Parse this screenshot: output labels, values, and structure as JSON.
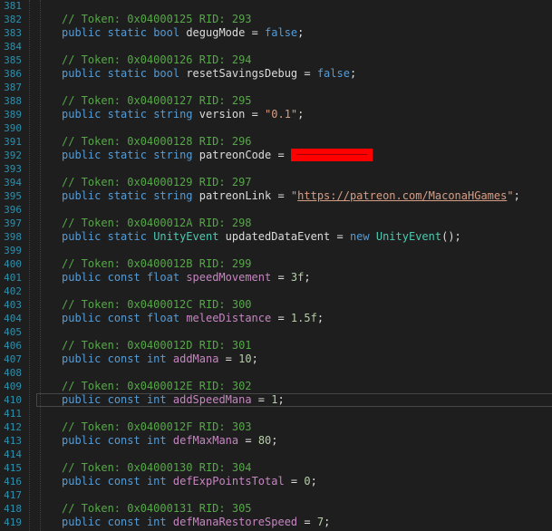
{
  "editor": {
    "current_line": "410",
    "lines": [
      {
        "n": "381",
        "code": []
      },
      {
        "n": "382",
        "code": [
          {
            "t": "// Token: 0x04000125 RID: 293",
            "c": "cm"
          }
        ]
      },
      {
        "n": "383",
        "code": [
          {
            "t": "public",
            "c": "kw"
          },
          {
            "t": " "
          },
          {
            "t": "static",
            "c": "kw"
          },
          {
            "t": " "
          },
          {
            "t": "bool",
            "c": "kw"
          },
          {
            "t": " degugMode = "
          },
          {
            "t": "false",
            "c": "kw"
          },
          {
            "t": ";"
          }
        ]
      },
      {
        "n": "384",
        "code": []
      },
      {
        "n": "385",
        "code": [
          {
            "t": "// Token: 0x04000126 RID: 294",
            "c": "cm"
          }
        ]
      },
      {
        "n": "386",
        "code": [
          {
            "t": "public",
            "c": "kw"
          },
          {
            "t": " "
          },
          {
            "t": "static",
            "c": "kw"
          },
          {
            "t": " "
          },
          {
            "t": "bool",
            "c": "kw"
          },
          {
            "t": " resetSavingsDebug = "
          },
          {
            "t": "false",
            "c": "kw"
          },
          {
            "t": ";"
          }
        ]
      },
      {
        "n": "387",
        "code": []
      },
      {
        "n": "388",
        "code": [
          {
            "t": "// Token: 0x04000127 RID: 295",
            "c": "cm"
          }
        ]
      },
      {
        "n": "389",
        "code": [
          {
            "t": "public",
            "c": "kw"
          },
          {
            "t": " "
          },
          {
            "t": "static",
            "c": "kw"
          },
          {
            "t": " "
          },
          {
            "t": "string",
            "c": "kw"
          },
          {
            "t": " version = "
          },
          {
            "t": "\"0.1\"",
            "c": "str"
          },
          {
            "t": ";"
          }
        ]
      },
      {
        "n": "390",
        "code": []
      },
      {
        "n": "391",
        "code": [
          {
            "t": "// Token: 0x04000128 RID: 296",
            "c": "cm"
          }
        ]
      },
      {
        "n": "392",
        "code": [
          {
            "t": "public",
            "c": "kw"
          },
          {
            "t": " "
          },
          {
            "t": "static",
            "c": "kw"
          },
          {
            "t": " "
          },
          {
            "t": "string",
            "c": "kw"
          },
          {
            "t": " patreonCode = "
          },
          {
            "t": "",
            "c": "redact"
          }
        ]
      },
      {
        "n": "393",
        "code": []
      },
      {
        "n": "394",
        "code": [
          {
            "t": "// Token: 0x04000129 RID: 297",
            "c": "cm"
          }
        ]
      },
      {
        "n": "395",
        "code": [
          {
            "t": "public",
            "c": "kw"
          },
          {
            "t": " "
          },
          {
            "t": "static",
            "c": "kw"
          },
          {
            "t": " "
          },
          {
            "t": "string",
            "c": "kw"
          },
          {
            "t": " patreonLink = "
          },
          {
            "t": "\"",
            "c": "str"
          },
          {
            "t": "https://patreon.com/MaconaHGames",
            "c": "lnk"
          },
          {
            "t": "\"",
            "c": "str"
          },
          {
            "t": ";"
          }
        ]
      },
      {
        "n": "396",
        "code": []
      },
      {
        "n": "397",
        "code": [
          {
            "t": "// Token: 0x0400012A RID: 298",
            "c": "cm"
          }
        ]
      },
      {
        "n": "398",
        "code": [
          {
            "t": "public",
            "c": "kw"
          },
          {
            "t": " "
          },
          {
            "t": "static",
            "c": "kw"
          },
          {
            "t": " "
          },
          {
            "t": "UnityEvent",
            "c": "typ"
          },
          {
            "t": " updatedDataEvent = "
          },
          {
            "t": "new",
            "c": "kw"
          },
          {
            "t": " "
          },
          {
            "t": "UnityEvent",
            "c": "typ"
          },
          {
            "t": "();"
          }
        ]
      },
      {
        "n": "399",
        "code": []
      },
      {
        "n": "400",
        "code": [
          {
            "t": "// Token: 0x0400012B RID: 299",
            "c": "cm"
          }
        ]
      },
      {
        "n": "401",
        "code": [
          {
            "t": "public",
            "c": "kw"
          },
          {
            "t": " "
          },
          {
            "t": "const",
            "c": "kw"
          },
          {
            "t": " "
          },
          {
            "t": "float",
            "c": "kw"
          },
          {
            "t": " "
          },
          {
            "t": "speedMovement",
            "c": "cst"
          },
          {
            "t": " = "
          },
          {
            "t": "3f",
            "c": "num"
          },
          {
            "t": ";"
          }
        ]
      },
      {
        "n": "402",
        "code": []
      },
      {
        "n": "403",
        "code": [
          {
            "t": "// Token: 0x0400012C RID: 300",
            "c": "cm"
          }
        ]
      },
      {
        "n": "404",
        "code": [
          {
            "t": "public",
            "c": "kw"
          },
          {
            "t": " "
          },
          {
            "t": "const",
            "c": "kw"
          },
          {
            "t": " "
          },
          {
            "t": "float",
            "c": "kw"
          },
          {
            "t": " "
          },
          {
            "t": "meleeDistance",
            "c": "cst"
          },
          {
            "t": " = "
          },
          {
            "t": "1.5f",
            "c": "num"
          },
          {
            "t": ";"
          }
        ]
      },
      {
        "n": "405",
        "code": []
      },
      {
        "n": "406",
        "code": [
          {
            "t": "// Token: 0x0400012D RID: 301",
            "c": "cm"
          }
        ]
      },
      {
        "n": "407",
        "code": [
          {
            "t": "public",
            "c": "kw"
          },
          {
            "t": " "
          },
          {
            "t": "const",
            "c": "kw"
          },
          {
            "t": " "
          },
          {
            "t": "int",
            "c": "kw"
          },
          {
            "t": " "
          },
          {
            "t": "addMana",
            "c": "cst"
          },
          {
            "t": " = "
          },
          {
            "t": "10",
            "c": "num"
          },
          {
            "t": ";"
          }
        ]
      },
      {
        "n": "408",
        "code": []
      },
      {
        "n": "409",
        "code": [
          {
            "t": "// Token: 0x0400012E RID: 302",
            "c": "cm"
          }
        ]
      },
      {
        "n": "410",
        "code": [
          {
            "t": "public",
            "c": "kw"
          },
          {
            "t": " "
          },
          {
            "t": "const",
            "c": "kw"
          },
          {
            "t": " "
          },
          {
            "t": "int",
            "c": "kw"
          },
          {
            "t": " "
          },
          {
            "t": "addSpeedMana",
            "c": "cst"
          },
          {
            "t": " = "
          },
          {
            "t": "1",
            "c": "num"
          },
          {
            "t": ";"
          }
        ]
      },
      {
        "n": "411",
        "code": []
      },
      {
        "n": "412",
        "code": [
          {
            "t": "// Token: 0x0400012F RID: 303",
            "c": "cm"
          }
        ]
      },
      {
        "n": "413",
        "code": [
          {
            "t": "public",
            "c": "kw"
          },
          {
            "t": " "
          },
          {
            "t": "const",
            "c": "kw"
          },
          {
            "t": " "
          },
          {
            "t": "int",
            "c": "kw"
          },
          {
            "t": " "
          },
          {
            "t": "defMaxMana",
            "c": "cst"
          },
          {
            "t": " = "
          },
          {
            "t": "80",
            "c": "num"
          },
          {
            "t": ";"
          }
        ]
      },
      {
        "n": "414",
        "code": []
      },
      {
        "n": "415",
        "code": [
          {
            "t": "// Token: 0x04000130 RID: 304",
            "c": "cm"
          }
        ]
      },
      {
        "n": "416",
        "code": [
          {
            "t": "public",
            "c": "kw"
          },
          {
            "t": " "
          },
          {
            "t": "const",
            "c": "kw"
          },
          {
            "t": " "
          },
          {
            "t": "int",
            "c": "kw"
          },
          {
            "t": " "
          },
          {
            "t": "defExpPointsTotal",
            "c": "cst"
          },
          {
            "t": " = "
          },
          {
            "t": "0",
            "c": "num"
          },
          {
            "t": ";"
          }
        ]
      },
      {
        "n": "417",
        "code": []
      },
      {
        "n": "418",
        "code": [
          {
            "t": "// Token: 0x04000131 RID: 305",
            "c": "cm"
          }
        ]
      },
      {
        "n": "419",
        "code": [
          {
            "t": "public",
            "c": "kw"
          },
          {
            "t": " "
          },
          {
            "t": "const",
            "c": "kw"
          },
          {
            "t": " "
          },
          {
            "t": "int",
            "c": "kw"
          },
          {
            "t": " "
          },
          {
            "t": "defManaRestoreSpeed",
            "c": "cst"
          },
          {
            "t": " = "
          },
          {
            "t": "7",
            "c": "num"
          },
          {
            "t": ";"
          }
        ]
      }
    ]
  }
}
